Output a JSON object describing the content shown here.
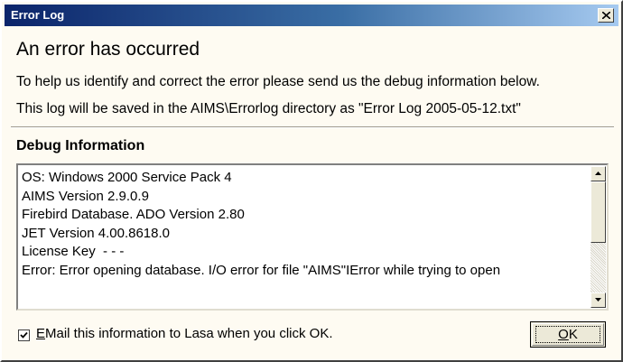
{
  "window": {
    "title": "Error Log"
  },
  "header": {
    "heading": "An error has occurred",
    "line1": "To help us identify and correct the error please send us the debug information below.",
    "line2": "This log will be saved in the AIMS\\Errorlog directory as \"Error Log 2005-05-12.txt\""
  },
  "debug": {
    "title": "Debug Information",
    "lines": [
      "OS: Windows 2000 Service Pack 4",
      "AIMS Version 2.9.0.9",
      "Firebird Database. ADO Version 2.80",
      "JET Version 4.00.8618.0",
      "License Key  - - -",
      "",
      "Error: Error opening database. I/O error for file \"AIMS\"IError while trying to open"
    ]
  },
  "footer": {
    "email_checked": true,
    "email_hotkey": "E",
    "email_label_rest": "Mail this information to Lasa when you click OK.",
    "ok_hotkey": "O",
    "ok_rest": "K"
  },
  "icons": {
    "close": "close-icon",
    "scroll_up": "arrow-up-icon",
    "scroll_down": "arrow-down-icon",
    "check": "check-icon"
  }
}
